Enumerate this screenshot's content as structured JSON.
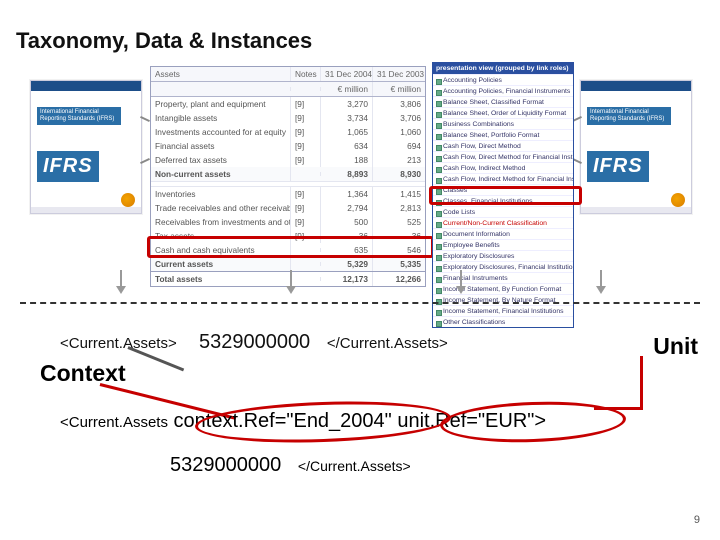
{
  "title": "Taxonomy, Data & Instances",
  "context_label": "Context",
  "unit_label": "Unit",
  "page_number": "9",
  "ifrs_card": {
    "strap": "International Financial Reporting Standards (IFRS)",
    "brand": "IFRS"
  },
  "fintable": {
    "header": {
      "c0": "Assets",
      "c1": "Notes",
      "c2": "31 Dec 2004",
      "c3": "31 Dec 2003"
    },
    "unit_row": {
      "c0": "",
      "c1": "",
      "c2": "€ million",
      "c3": "€ million"
    },
    "rows": [
      {
        "label": "Property, plant and equipment",
        "note": "[9]",
        "v1": "3,270",
        "v2": "3,806"
      },
      {
        "label": "Intangible assets",
        "note": "[9]",
        "v1": "3,734",
        "v2": "3,706"
      },
      {
        "label": "Investments accounted for at equity",
        "note": "[9]",
        "v1": "1,065",
        "v2": "1,060"
      },
      {
        "label": "Financial assets",
        "note": "[9]",
        "v1": "634",
        "v2": "694"
      },
      {
        "label": "Deferred tax assets",
        "note": "[9]",
        "v1": "188",
        "v2": "213"
      },
      {
        "label": "Non-current assets",
        "note": "",
        "v1": "8,893",
        "v2": "8,930",
        "sub": true
      },
      {
        "spacer": true
      },
      {
        "label": "Inventories",
        "note": "[9]",
        "v1": "1,364",
        "v2": "1,415"
      },
      {
        "label": "Trade receivables and other receivables",
        "note": "[9]",
        "v1": "2,794",
        "v2": "2,813"
      },
      {
        "label": "Receivables from investments and other assets",
        "note": "[9]",
        "v1": "500",
        "v2": "525"
      },
      {
        "label": "Tax assets",
        "note": "[9]",
        "v1": "36",
        "v2": "36"
      },
      {
        "label": "Cash and cash equivalents",
        "note": "",
        "v1": "635",
        "v2": "546"
      },
      {
        "label": "Current assets",
        "note": "",
        "v1": "5,329",
        "v2": "5,335",
        "sub": true
      },
      {
        "label": "Total assets",
        "note": "",
        "v1": "12,173",
        "v2": "12,266",
        "total": true
      }
    ]
  },
  "panel": {
    "header": "presentation view (grouped by link roles)",
    "items": [
      "Accounting Policies",
      "Accounting Policies, Financial Instruments",
      "Balance Sheet, Classified Format",
      "Balance Sheet, Order of Liquidity Format",
      "Business Combinations",
      "Balance Sheet, Portfolio Format",
      "Cash Flow, Direct Method",
      "Cash Flow, Direct Method for Financial Inst.",
      "Cash Flow, Indirect Method",
      "Cash Flow, Indirect Method for Financial Inst.",
      "Classes",
      "Classes, Financial Institutions",
      "Code Lists",
      "Current/Non-Current Classification",
      "Document Information",
      "Employee Benefits",
      "Exploratory Disclosures",
      "Exploratory Disclosures, Financial Institutions",
      "Financial Instruments",
      "Income Statement, By Function Format",
      "Income Statement, By Nature Format",
      "Income Statement, Financial Institutions",
      "Other Classifications"
    ]
  },
  "code": {
    "open_tag": "<Current.Assets>",
    "value": "5329000000",
    "close_tag": "</Current.Assets>",
    "line2_open": "<Current.Assets",
    "line2_ctx": "context.Ref=\"End_2004\"",
    "line2_unit": "unit.Ref=\"EUR\">",
    "line3_value": "5329000000",
    "line3_close": "</Current.Assets>"
  }
}
